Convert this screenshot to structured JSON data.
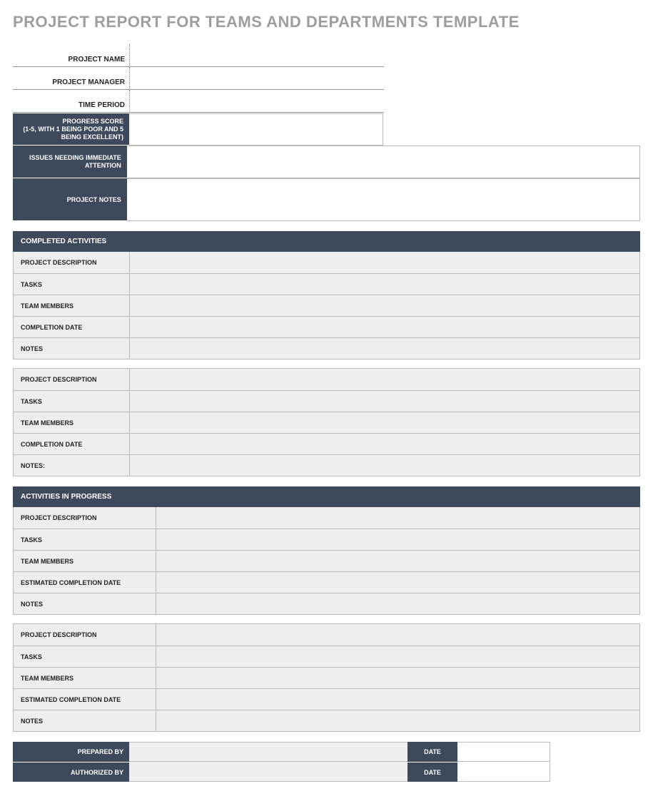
{
  "title": "PROJECT REPORT FOR TEAMS AND DEPARTMENTS TEMPLATE",
  "header_fields": {
    "project_name": {
      "label": "PROJECT NAME",
      "value": ""
    },
    "project_manager": {
      "label": "PROJECT MANAGER",
      "value": ""
    },
    "time_period": {
      "label": "TIME PERIOD",
      "value": ""
    }
  },
  "summary_fields": {
    "progress_score": {
      "label": "PROGRESS SCORE\n(1-5, WITH 1 BEING POOR AND 5 BEING EXCELLENT)",
      "value": ""
    },
    "issues": {
      "label": "ISSUES NEEDING IMMEDIATE ATTENTION",
      "value": ""
    },
    "project_notes": {
      "label": "PROJECT NOTES",
      "value": ""
    }
  },
  "sections": {
    "completed": {
      "header": "COMPLETED ACTIVITIES",
      "blocks": [
        {
          "rows": [
            {
              "label": "PROJECT DESCRIPTION",
              "value": ""
            },
            {
              "label": "TASKS",
              "value": ""
            },
            {
              "label": "TEAM MEMBERS",
              "value": ""
            },
            {
              "label": "COMPLETION DATE",
              "value": ""
            },
            {
              "label": "NOTES",
              "value": ""
            }
          ]
        },
        {
          "rows": [
            {
              "label": "PROJECT DESCRIPTION",
              "value": ""
            },
            {
              "label": "TASKS",
              "value": ""
            },
            {
              "label": "TEAM MEMBERS",
              "value": ""
            },
            {
              "label": "COMPLETION DATE",
              "value": ""
            },
            {
              "label": "NOTES:",
              "value": ""
            }
          ]
        }
      ]
    },
    "in_progress": {
      "header": "ACTIVITIES IN PROGRESS",
      "blocks": [
        {
          "rows": [
            {
              "label": "PROJECT DESCRIPTION",
              "value": ""
            },
            {
              "label": "TASKS",
              "value": ""
            },
            {
              "label": "TEAM MEMBERS",
              "value": ""
            },
            {
              "label": "ESTIMATED COMPLETION DATE",
              "value": ""
            },
            {
              "label": "NOTES",
              "value": ""
            }
          ]
        },
        {
          "rows": [
            {
              "label": "PROJECT DESCRIPTION",
              "value": ""
            },
            {
              "label": "TASKS",
              "value": ""
            },
            {
              "label": "TEAM MEMBERS",
              "value": ""
            },
            {
              "label": "ESTIMATED COMPLETION DATE",
              "value": ""
            },
            {
              "label": "NOTES",
              "value": ""
            }
          ]
        }
      ]
    }
  },
  "signoff": {
    "prepared_by": {
      "label": "PREPARED BY",
      "value": "",
      "date_label": "DATE",
      "date_value": ""
    },
    "authorized_by": {
      "label": "AUTHORIZED BY",
      "value": "",
      "date_label": "DATE",
      "date_value": ""
    }
  }
}
